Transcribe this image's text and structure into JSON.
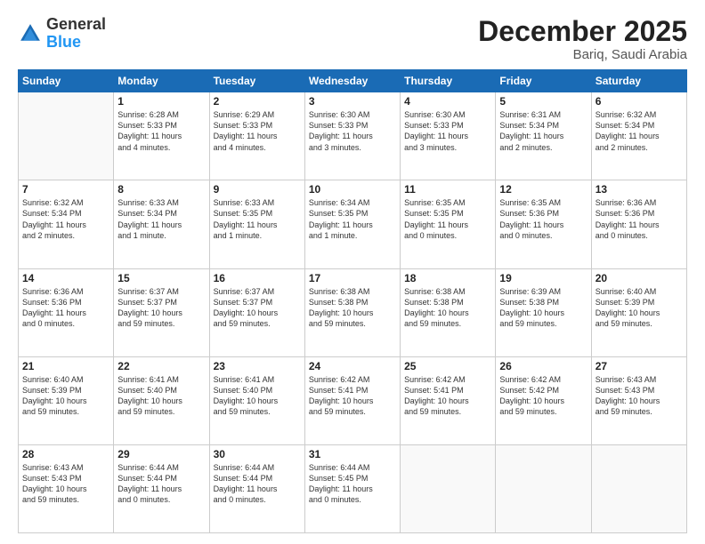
{
  "logo": {
    "general": "General",
    "blue": "Blue"
  },
  "header": {
    "month": "December 2025",
    "location": "Bariq, Saudi Arabia"
  },
  "weekdays": [
    "Sunday",
    "Monday",
    "Tuesday",
    "Wednesday",
    "Thursday",
    "Friday",
    "Saturday"
  ],
  "weeks": [
    [
      {
        "day": "",
        "info": ""
      },
      {
        "day": "1",
        "info": "Sunrise: 6:28 AM\nSunset: 5:33 PM\nDaylight: 11 hours\nand 4 minutes."
      },
      {
        "day": "2",
        "info": "Sunrise: 6:29 AM\nSunset: 5:33 PM\nDaylight: 11 hours\nand 4 minutes."
      },
      {
        "day": "3",
        "info": "Sunrise: 6:30 AM\nSunset: 5:33 PM\nDaylight: 11 hours\nand 3 minutes."
      },
      {
        "day": "4",
        "info": "Sunrise: 6:30 AM\nSunset: 5:33 PM\nDaylight: 11 hours\nand 3 minutes."
      },
      {
        "day": "5",
        "info": "Sunrise: 6:31 AM\nSunset: 5:34 PM\nDaylight: 11 hours\nand 2 minutes."
      },
      {
        "day": "6",
        "info": "Sunrise: 6:32 AM\nSunset: 5:34 PM\nDaylight: 11 hours\nand 2 minutes."
      }
    ],
    [
      {
        "day": "7",
        "info": "Sunrise: 6:32 AM\nSunset: 5:34 PM\nDaylight: 11 hours\nand 2 minutes."
      },
      {
        "day": "8",
        "info": "Sunrise: 6:33 AM\nSunset: 5:34 PM\nDaylight: 11 hours\nand 1 minute."
      },
      {
        "day": "9",
        "info": "Sunrise: 6:33 AM\nSunset: 5:35 PM\nDaylight: 11 hours\nand 1 minute."
      },
      {
        "day": "10",
        "info": "Sunrise: 6:34 AM\nSunset: 5:35 PM\nDaylight: 11 hours\nand 1 minute."
      },
      {
        "day": "11",
        "info": "Sunrise: 6:35 AM\nSunset: 5:35 PM\nDaylight: 11 hours\nand 0 minutes."
      },
      {
        "day": "12",
        "info": "Sunrise: 6:35 AM\nSunset: 5:36 PM\nDaylight: 11 hours\nand 0 minutes."
      },
      {
        "day": "13",
        "info": "Sunrise: 6:36 AM\nSunset: 5:36 PM\nDaylight: 11 hours\nand 0 minutes."
      }
    ],
    [
      {
        "day": "14",
        "info": "Sunrise: 6:36 AM\nSunset: 5:36 PM\nDaylight: 11 hours\nand 0 minutes."
      },
      {
        "day": "15",
        "info": "Sunrise: 6:37 AM\nSunset: 5:37 PM\nDaylight: 10 hours\nand 59 minutes."
      },
      {
        "day": "16",
        "info": "Sunrise: 6:37 AM\nSunset: 5:37 PM\nDaylight: 10 hours\nand 59 minutes."
      },
      {
        "day": "17",
        "info": "Sunrise: 6:38 AM\nSunset: 5:38 PM\nDaylight: 10 hours\nand 59 minutes."
      },
      {
        "day": "18",
        "info": "Sunrise: 6:38 AM\nSunset: 5:38 PM\nDaylight: 10 hours\nand 59 minutes."
      },
      {
        "day": "19",
        "info": "Sunrise: 6:39 AM\nSunset: 5:38 PM\nDaylight: 10 hours\nand 59 minutes."
      },
      {
        "day": "20",
        "info": "Sunrise: 6:40 AM\nSunset: 5:39 PM\nDaylight: 10 hours\nand 59 minutes."
      }
    ],
    [
      {
        "day": "21",
        "info": "Sunrise: 6:40 AM\nSunset: 5:39 PM\nDaylight: 10 hours\nand 59 minutes."
      },
      {
        "day": "22",
        "info": "Sunrise: 6:41 AM\nSunset: 5:40 PM\nDaylight: 10 hours\nand 59 minutes."
      },
      {
        "day": "23",
        "info": "Sunrise: 6:41 AM\nSunset: 5:40 PM\nDaylight: 10 hours\nand 59 minutes."
      },
      {
        "day": "24",
        "info": "Sunrise: 6:42 AM\nSunset: 5:41 PM\nDaylight: 10 hours\nand 59 minutes."
      },
      {
        "day": "25",
        "info": "Sunrise: 6:42 AM\nSunset: 5:41 PM\nDaylight: 10 hours\nand 59 minutes."
      },
      {
        "day": "26",
        "info": "Sunrise: 6:42 AM\nSunset: 5:42 PM\nDaylight: 10 hours\nand 59 minutes."
      },
      {
        "day": "27",
        "info": "Sunrise: 6:43 AM\nSunset: 5:43 PM\nDaylight: 10 hours\nand 59 minutes."
      }
    ],
    [
      {
        "day": "28",
        "info": "Sunrise: 6:43 AM\nSunset: 5:43 PM\nDaylight: 10 hours\nand 59 minutes."
      },
      {
        "day": "29",
        "info": "Sunrise: 6:44 AM\nSunset: 5:44 PM\nDaylight: 11 hours\nand 0 minutes."
      },
      {
        "day": "30",
        "info": "Sunrise: 6:44 AM\nSunset: 5:44 PM\nDaylight: 11 hours\nand 0 minutes."
      },
      {
        "day": "31",
        "info": "Sunrise: 6:44 AM\nSunset: 5:45 PM\nDaylight: 11 hours\nand 0 minutes."
      },
      {
        "day": "",
        "info": ""
      },
      {
        "day": "",
        "info": ""
      },
      {
        "day": "",
        "info": ""
      }
    ]
  ]
}
